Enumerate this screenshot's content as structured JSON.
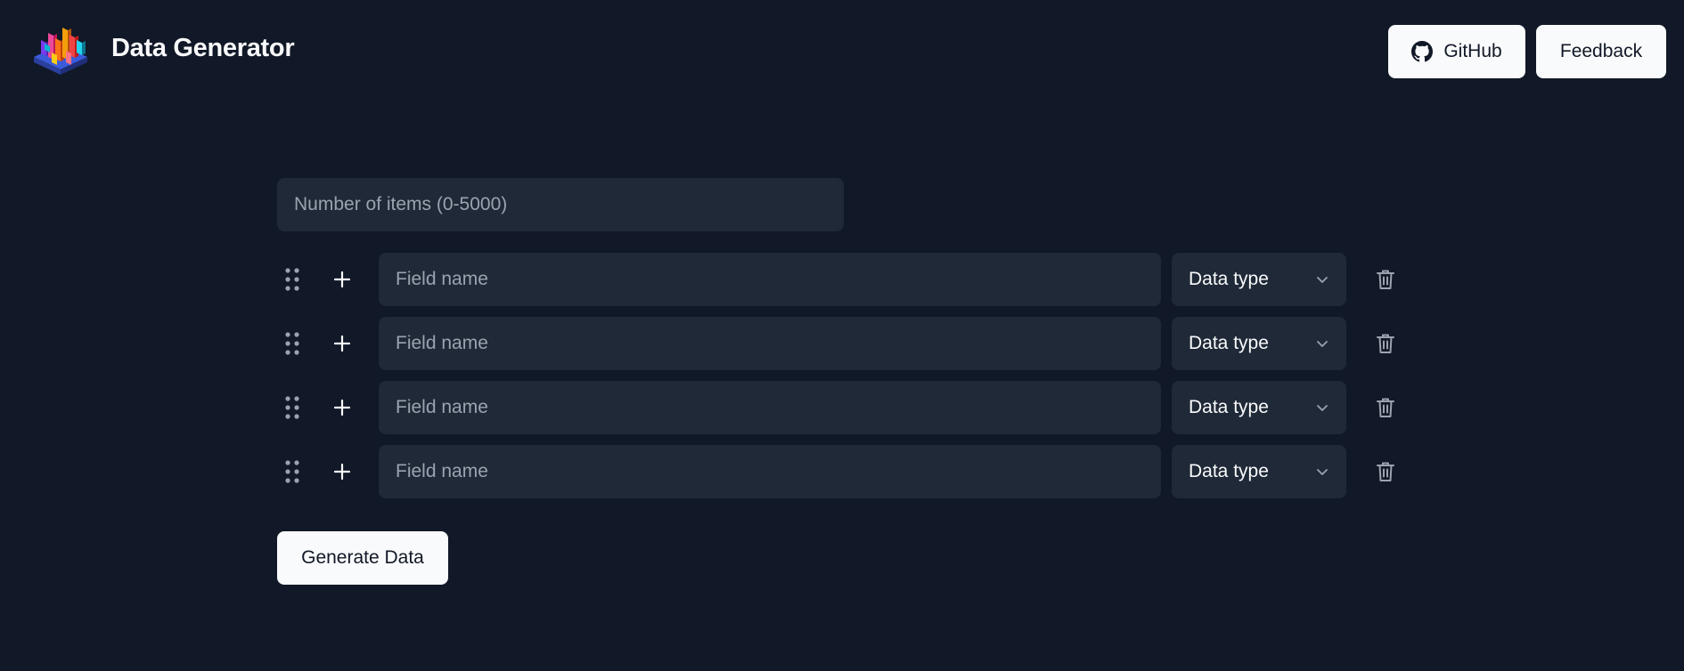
{
  "header": {
    "logo_icon": "isometric-bar-chart-logo-icon",
    "title": "Data Generator",
    "github_label": "GitHub",
    "github_icon": "github-icon",
    "feedback_label": "Feedback"
  },
  "form": {
    "count_placeholder": "Number of items (0-5000)",
    "count_value": "",
    "fields": [
      {
        "name_placeholder": "Field name",
        "name_value": "",
        "type_label": "Data type"
      },
      {
        "name_placeholder": "Field name",
        "name_value": "",
        "type_label": "Data type"
      },
      {
        "name_placeholder": "Field name",
        "name_value": "",
        "type_label": "Data type"
      },
      {
        "name_placeholder": "Field name",
        "name_value": "",
        "type_label": "Data type"
      }
    ],
    "row_icons": {
      "drag": "drag-handle-icon",
      "add": "plus-icon",
      "chevron": "chevron-down-icon",
      "delete": "trash-icon"
    },
    "generate_label": "Generate Data"
  },
  "colors": {
    "background": "#111827",
    "input_background": "#1f2937",
    "button_background": "#f9fafb",
    "text": "#f9fafb",
    "placeholder": "#9ca3af",
    "icon_muted": "#9ca3af"
  }
}
